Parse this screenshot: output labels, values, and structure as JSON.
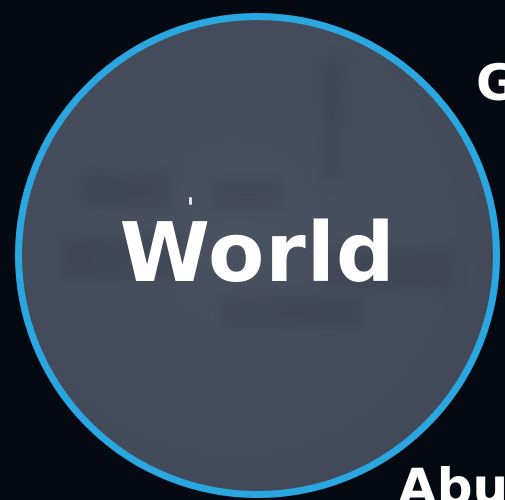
{
  "main_node": {
    "label": "World",
    "border_color": "#2aa7e0",
    "fill_color": "#444c5c"
  },
  "neighbors": {
    "top_right_label": "G",
    "bottom_label": "Abu"
  },
  "background_color": "#040912"
}
